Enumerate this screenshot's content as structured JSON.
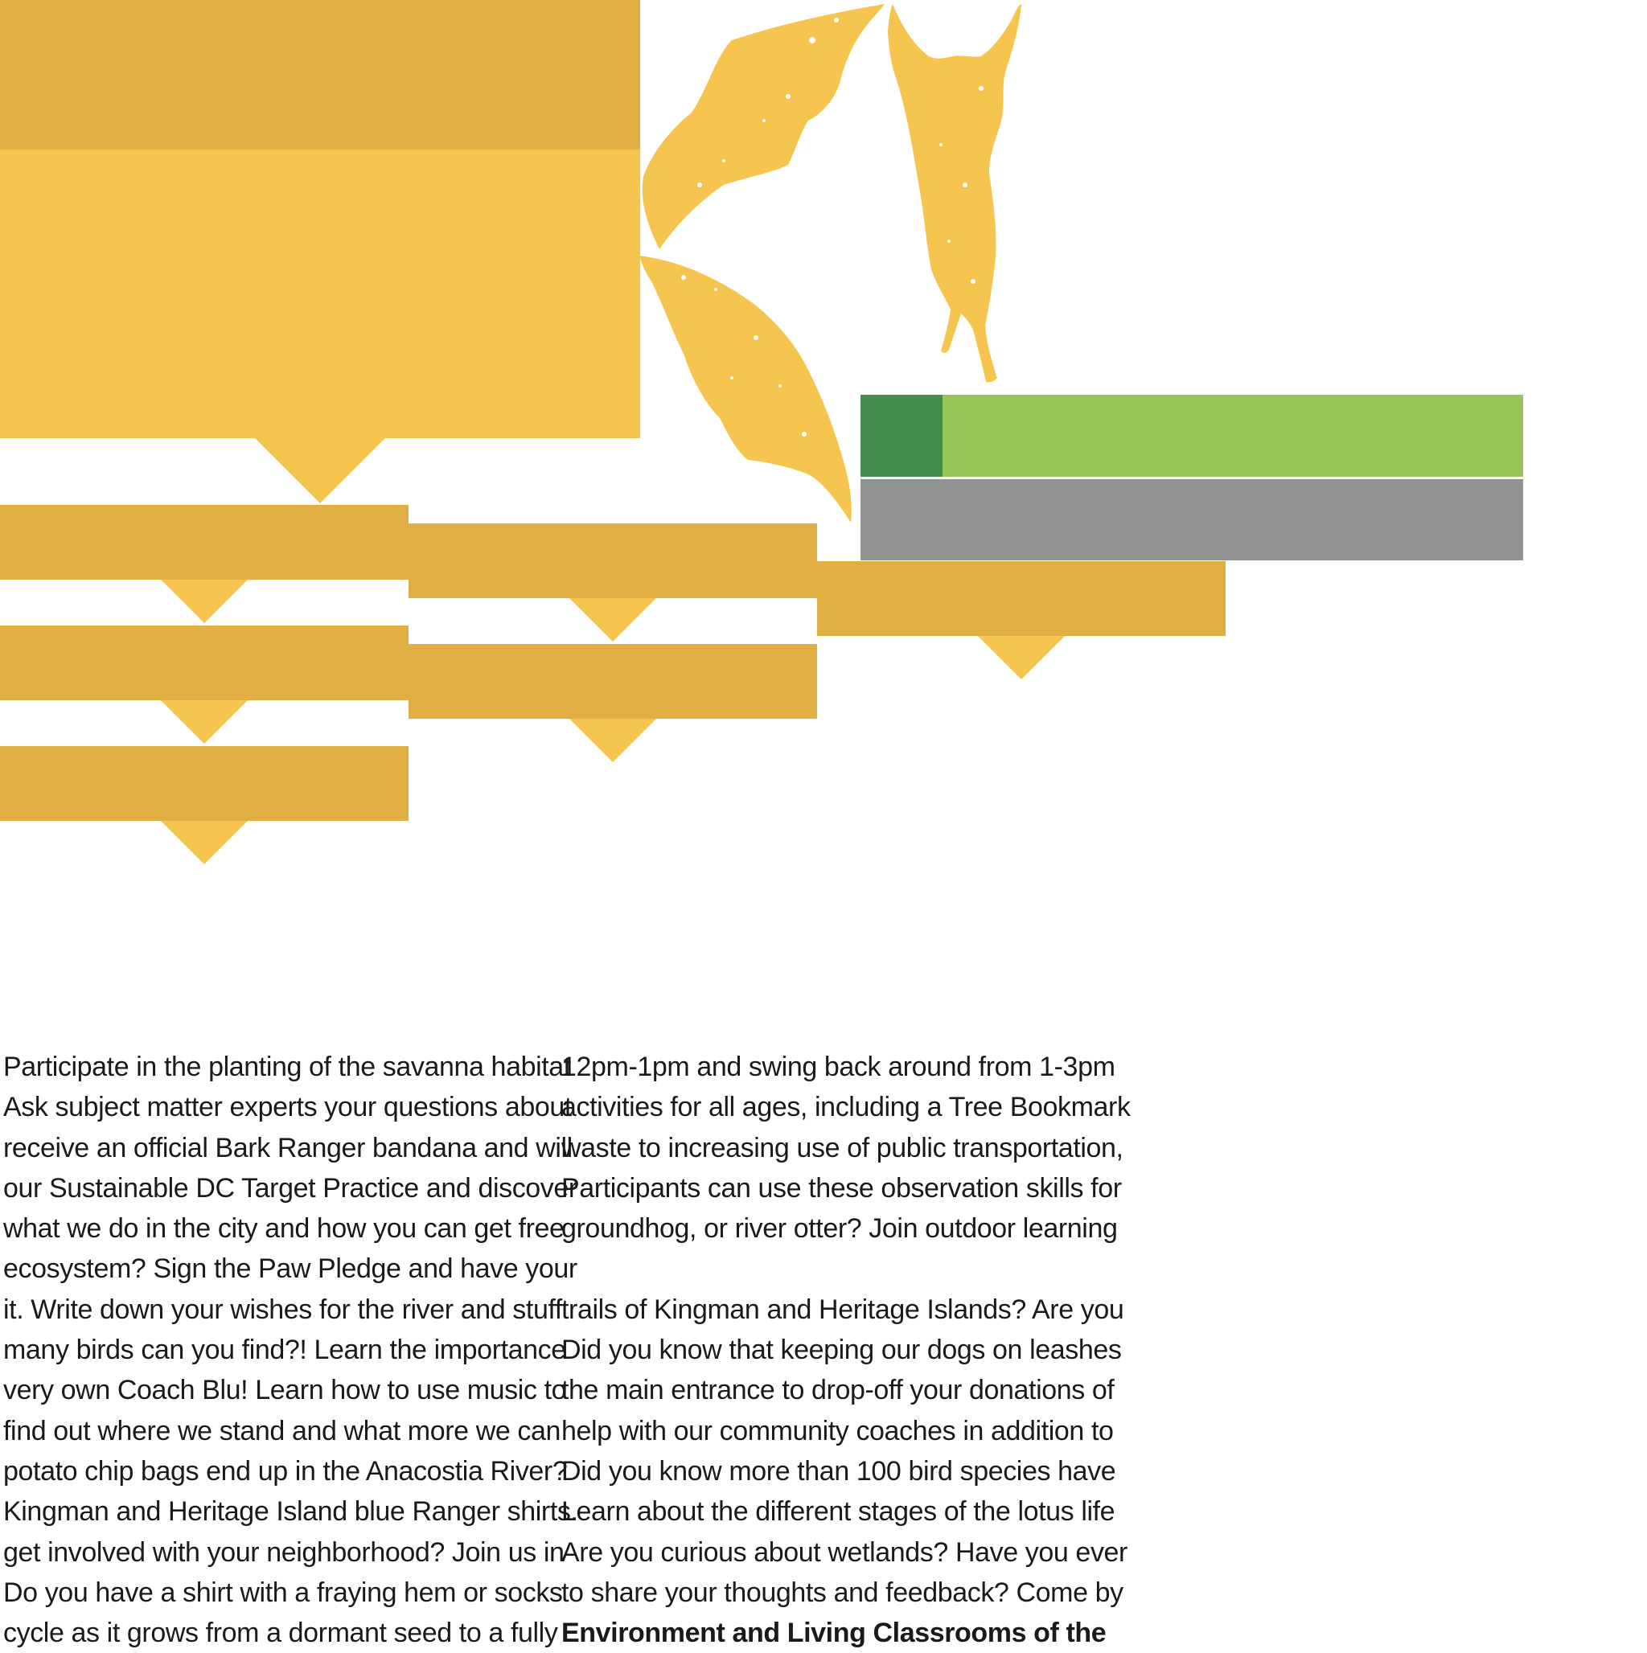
{
  "colors": {
    "gold_dark": "#E0AE42",
    "gold_light": "#F5C54F",
    "green_dark": "#468C4C",
    "green_light": "#97C457",
    "grey": "#929292"
  },
  "decorations": {
    "illustration": "bats-silhouette-icon"
  },
  "text": {
    "left_column": [
      "Participate in the planting of the savanna habitat",
      "Ask subject matter experts your questions about",
      "receive an official Bark Ranger bandana and will",
      "our Sustainable DC Target Practice and discover",
      "what we do in the city and how you can get free",
      "ecosystem? Sign the Paw Pledge and have your",
      "it. Write down your wishes for the river and stuff",
      "many birds can you find?! Learn the importance",
      "very own Coach Blu! Learn how to use music to",
      "find out where we stand and what more we can",
      "potato chip bags end up in the Anacostia River?",
      "Kingman and Heritage Island blue Ranger shirts.",
      "get involved with your neighborhood? Join us in",
      "Do you have a shirt with a fraying hem or socks",
      "cycle as it grows from a dormant seed to a fully"
    ],
    "right_column_top": [
      "12pm-1pm and swing back around from 1-3pm",
      "activities for all ages, including a Tree Bookmark",
      "waste to increasing use of public transportation,",
      "Participants can use these observation skills for",
      "groundhog, or river otter? Join outdoor learning"
    ],
    "right_column_bottom": [
      "trails of Kingman and Heritage Islands? Are you",
      "Did you know that keeping our dogs on leashes",
      "the main entrance to drop-off your donations of",
      "help with our community coaches in addition to",
      "Did you know more than 100 bird species have",
      "Learn about the different stages of the lotus life",
      "Are you curious about wetlands? Have you ever",
      "to share your thoughts and feedback? Come by"
    ],
    "right_column_bold": "Environment and Living Classrooms of the"
  }
}
